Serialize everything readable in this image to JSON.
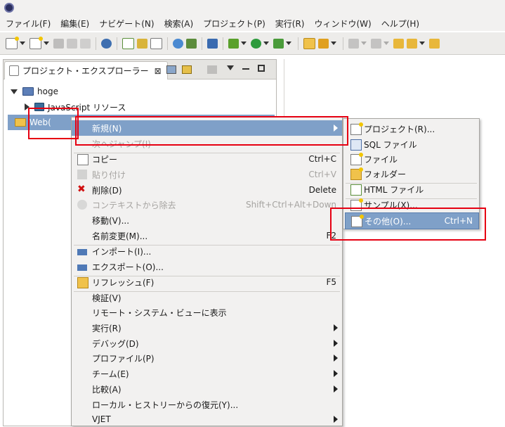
{
  "menubar": {
    "items": [
      "ファイル(F)",
      "編集(E)",
      "ナビゲート(N)",
      "検索(A)",
      "プロジェクト(P)",
      "実行(R)",
      "ウィンドウ(W)",
      "ヘルプ(H)"
    ]
  },
  "explorer": {
    "tab_title": "プロジェクト・エクスプローラー",
    "close_glyph": "⊠",
    "tree": {
      "project": "hoge",
      "js_resources": "JavaScript リソース",
      "web_folder": "Web("
    }
  },
  "context_menu": {
    "items": [
      {
        "label": "新規(N)",
        "accel": "",
        "submenu": true,
        "highlighted": true
      },
      {
        "label": "次へジャンプ(I)",
        "accel": "",
        "disabled": true
      },
      {
        "label": "コピー",
        "accel": "Ctrl+C"
      },
      {
        "label": "貼り付け",
        "accel": "Ctrl+V",
        "disabled": true
      },
      {
        "label": "削除(D)",
        "accel": "Delete"
      },
      {
        "label": "コンテキストから除去",
        "accel": "Shift+Ctrl+Alt+Down",
        "disabled": true
      },
      {
        "label": "移動(V)...",
        "accel": ""
      },
      {
        "label": "名前変更(M)...",
        "accel": "F2"
      },
      {
        "label": "インポート(I)...",
        "accel": ""
      },
      {
        "label": "エクスポート(O)...",
        "accel": ""
      },
      {
        "label": "リフレッシュ(F)",
        "accel": "F5"
      },
      {
        "label": "検証(V)",
        "accel": ""
      },
      {
        "label": "リモート・システム・ビューに表示",
        "accel": ""
      },
      {
        "label": "実行(R)",
        "accel": "",
        "submenu": true
      },
      {
        "label": "デバッグ(D)",
        "accel": "",
        "submenu": true
      },
      {
        "label": "プロファイル(P)",
        "accel": "",
        "submenu": true
      },
      {
        "label": "チーム(E)",
        "accel": "",
        "submenu": true
      },
      {
        "label": "比較(A)",
        "accel": "",
        "submenu": true
      },
      {
        "label": "ローカル・ヒストリーからの復元(Y)...",
        "accel": ""
      },
      {
        "label": "VJET",
        "accel": "",
        "submenu": true
      }
    ]
  },
  "new_submenu": {
    "items": [
      {
        "label": "プロジェクト(R)...",
        "accel": "",
        "icon": "project-icon"
      },
      {
        "label": "SQL ファイル",
        "accel": "",
        "icon": "sql-file-icon"
      },
      {
        "label": "ファイル",
        "accel": "",
        "icon": "file-icon"
      },
      {
        "label": "フォルダー",
        "accel": "",
        "icon": "folder-icon"
      },
      {
        "label": "HTML ファイル",
        "accel": "",
        "icon": "html-file-icon"
      },
      {
        "label": "サンプル(X)...",
        "accel": "",
        "icon": "sample-icon"
      },
      {
        "label": "その他(O)...",
        "accel": "Ctrl+N",
        "icon": "other-wizard-icon",
        "highlighted": true
      }
    ]
  },
  "colors": {
    "highlight": "#7fa0c8",
    "annotation_red": "#e60012",
    "menu_bg": "#f2f1f0"
  }
}
